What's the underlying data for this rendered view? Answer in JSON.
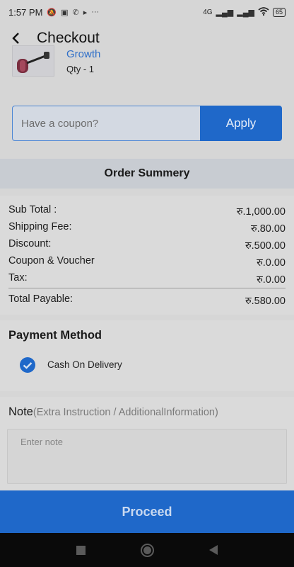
{
  "status_bar": {
    "time": "1:57 PM",
    "network_label": "4G",
    "battery": "65"
  },
  "header": {
    "title": "Checkout"
  },
  "product": {
    "name": "Growth",
    "qty": "Qty -  1"
  },
  "coupon": {
    "placeholder": "Have a coupon?",
    "value": "",
    "apply_label": "Apply"
  },
  "summary": {
    "title": "Order Summery",
    "rows": [
      {
        "label": "Sub Total :",
        "value": "रु.1,000.00"
      },
      {
        "label": "Shipping Fee:",
        "value": "रु.80.00"
      },
      {
        "label": "Discount:",
        "value": "रु.500.00"
      },
      {
        "label": "Coupon & Voucher",
        "value": "रु.0.00"
      },
      {
        "label": "Tax:",
        "value": "रु.0.00"
      }
    ],
    "total": {
      "label": "Total Payable:",
      "value": "रु.580.00"
    }
  },
  "payment": {
    "title": "Payment Method",
    "option_label": "Cash On Delivery",
    "option_checked": true
  },
  "note": {
    "title": "Note",
    "subtitle": "(Extra Instruction / AdditionalInformation)",
    "placeholder": "Enter note",
    "value": ""
  },
  "proceed_label": "Proceed",
  "colors": {
    "accent": "#1f68c9",
    "link": "#2f6fc8"
  }
}
